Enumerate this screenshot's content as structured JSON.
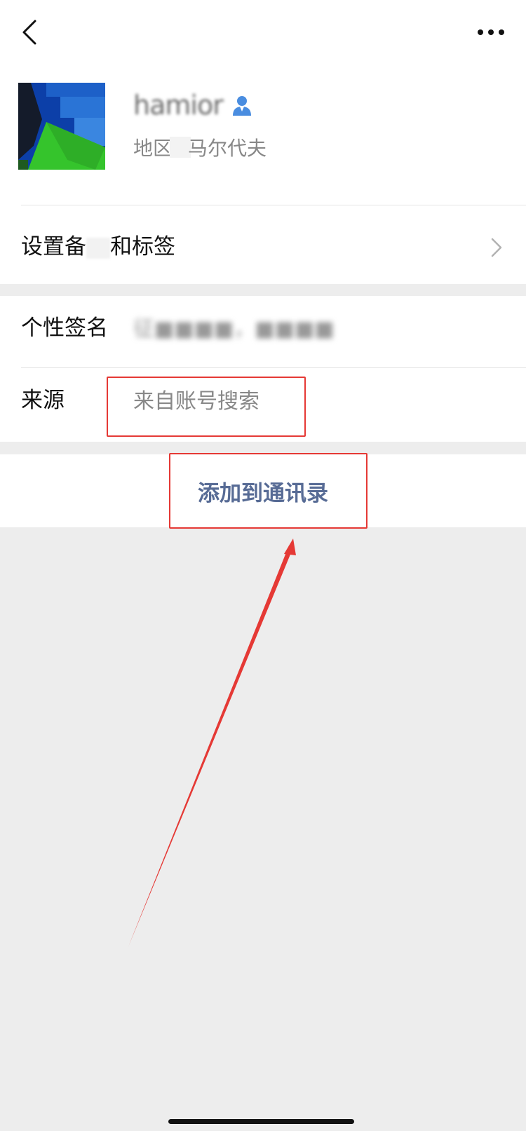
{
  "profile": {
    "nickname": "hamior",
    "region_label": "地区",
    "region_value": "马尔代夫",
    "badge_icon": "verified-user-icon"
  },
  "remark_row": {
    "label_part1": "设置备",
    "label_part2": "和标签"
  },
  "signature_row": {
    "label": "个性签名",
    "value": "征■■■■，■■■■"
  },
  "source_row": {
    "label": "来源",
    "value": "来自账号搜索"
  },
  "actions": {
    "add_contact_label": "添加到通讯录"
  },
  "colors": {
    "link_blue": "#576b95",
    "annotation_red": "#e53935",
    "background_gray": "#ededed"
  }
}
